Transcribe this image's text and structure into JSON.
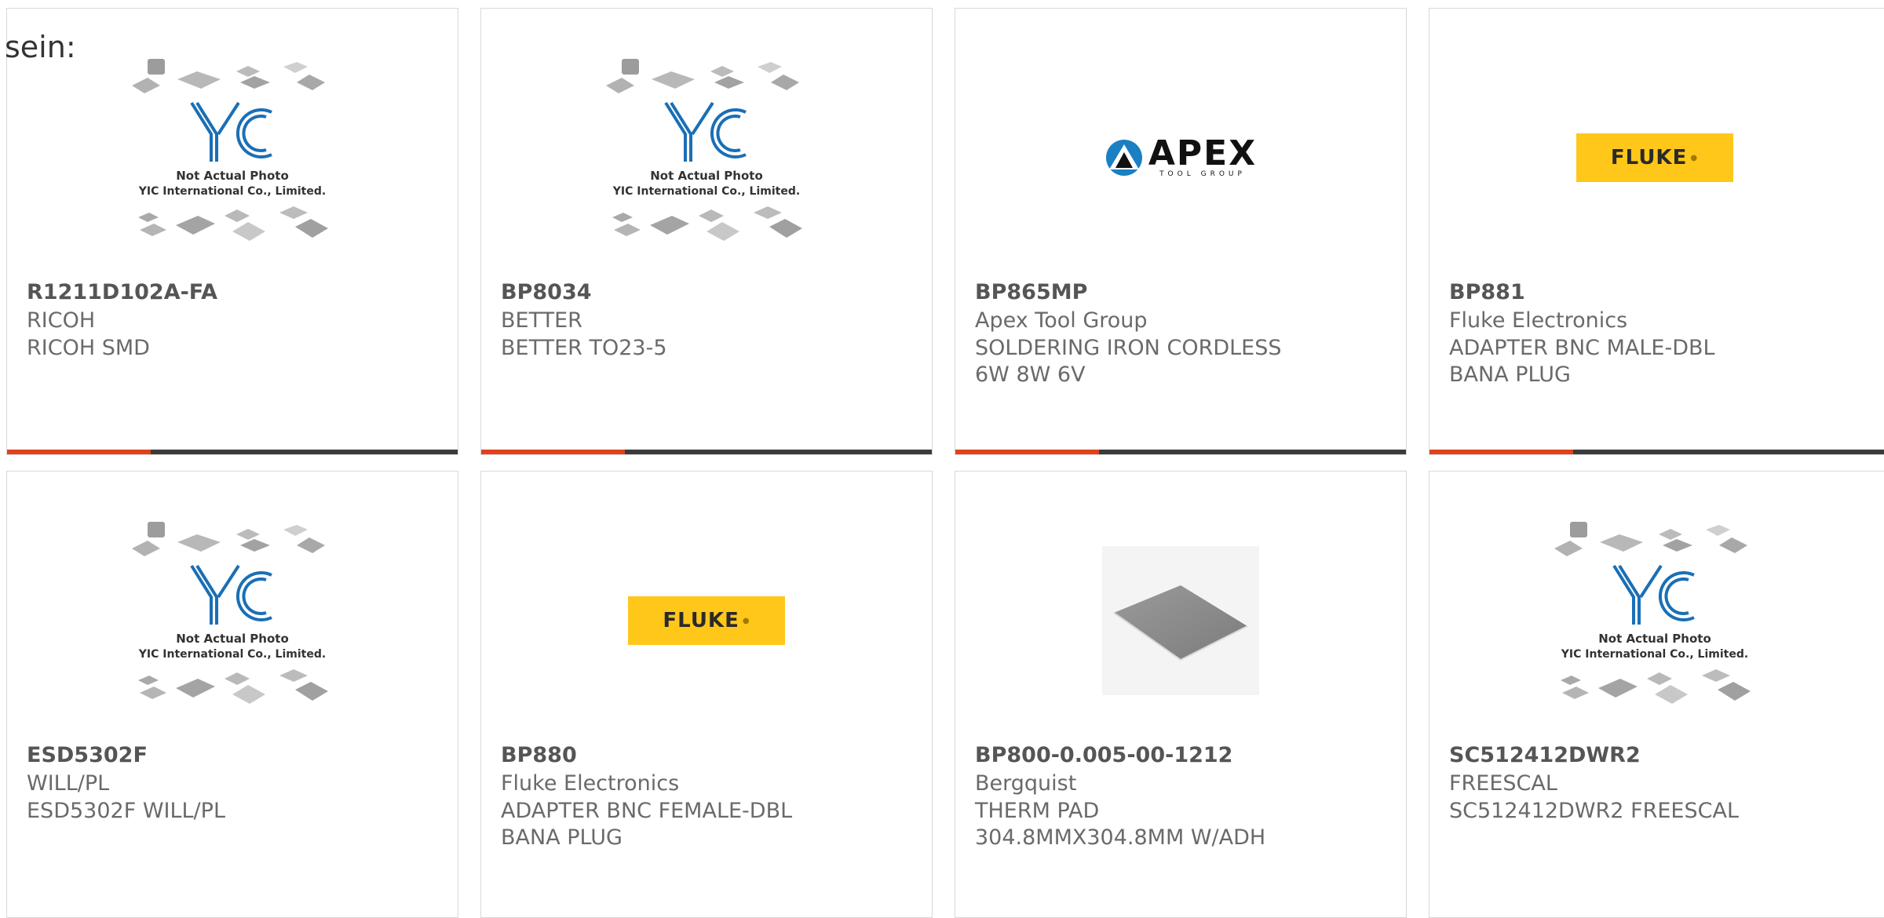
{
  "intro_text": "sein:",
  "placeholder_text": {
    "line1": "Not Actual Photo",
    "line2": "YIC International Co., Limited.",
    "brand": "YIC"
  },
  "logos": {
    "fluke": "FLUKE",
    "apex_main": "APEX",
    "apex_sub": "TOOL GROUP"
  },
  "colors": {
    "accent": "#e0421b",
    "bar": "#3b3b3b",
    "fluke_yellow": "#ffc71a",
    "yic_blue": "#1a6fb5"
  },
  "products": [
    {
      "part_number": "R1211D102A-FA",
      "manufacturer": "RICOH",
      "description": "RICOH SMD",
      "image": "yic-placeholder"
    },
    {
      "part_number": "BP8034",
      "manufacturer": "BETTER",
      "description": "BETTER TO23-5",
      "image": "yic-placeholder"
    },
    {
      "part_number": "BP865MP",
      "manufacturer": "Apex Tool Group",
      "description": "SOLDERING IRON CORDLESS 6W 8W 6V",
      "image": "apex-logo"
    },
    {
      "part_number": "BP881",
      "manufacturer": "Fluke Electronics",
      "description": "ADAPTER BNC MALE-DBL BANA PLUG",
      "image": "fluke-logo"
    },
    {
      "part_number": "ESD5302F",
      "manufacturer": "WILL/PL",
      "description": "ESD5302F WILL/PL",
      "image": "yic-placeholder"
    },
    {
      "part_number": "BP880",
      "manufacturer": "Fluke Electronics",
      "description": "ADAPTER BNC FEMALE-DBL BANA PLUG",
      "image": "fluke-logo"
    },
    {
      "part_number": "BP800-0.005-00-1212",
      "manufacturer": "Bergquist",
      "description": "THERM PAD 304.8MMX304.8MM W/ADH",
      "image": "thermal-pad"
    },
    {
      "part_number": "SC512412DWR2",
      "manufacturer": "FREESCAL",
      "description": "SC512412DWR2 FREESCAL",
      "image": "yic-placeholder"
    }
  ]
}
